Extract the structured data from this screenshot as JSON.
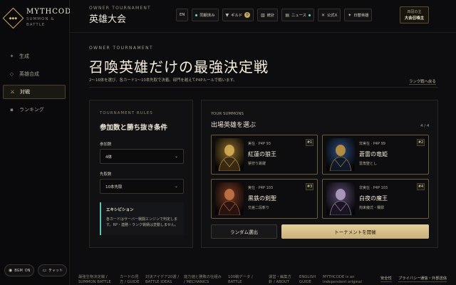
{
  "brand": {
    "name": "MYTHCODE",
    "tagline": "SUMMON & BATTLE",
    "badge": "◆◆◆"
  },
  "sidebar": {
    "items": [
      {
        "label": "生成",
        "icon": "sparkle-icon",
        "glyph": "✦",
        "active": false
      },
      {
        "label": "英雄合成",
        "icon": "diamond-icon",
        "glyph": "◇",
        "active": false
      },
      {
        "label": "対戦",
        "icon": "crossed-swords-icon",
        "glyph": "⚔",
        "active": true
      },
      {
        "label": "ランキング",
        "icon": "trophy-icon",
        "glyph": "▪",
        "active": false
      }
    ],
    "bgm_label": "BGM",
    "bgm_state": "ON",
    "chat_label": "チャット"
  },
  "header": {
    "eyebrow": "OWNER TOURNAMENT",
    "title": "英雄大会",
    "actions": {
      "lang": "EN",
      "synced": "同期済み",
      "guild": "ギルド",
      "guild_count": "0",
      "stats": "統計",
      "news": "ニュース",
      "official": "公式X",
      "daily": "日替英雄"
    },
    "profile": {
      "rank": "四冠の主",
      "title": "大会召喚主"
    }
  },
  "hero": {
    "eyebrow": "OWNER TOURNAMENT",
    "title": "召喚英雄だけの最強決定戦",
    "description": "2〜16体を選び、各カード1〜10本先取で決着。部門を越えてP4Pルールで戦います。",
    "ranking_link": "ランク戦へ戻る"
  },
  "rules": {
    "eyebrow": "TOURNAMENT RULES",
    "title": "参加数と勝ち抜き条件",
    "entrants_label": "参加数",
    "entrants_value": "4体",
    "first_to_label": "先取数",
    "first_to_value": "10本先取",
    "note_title": "エキシビション",
    "note_text": "各カードはサーバー戦闘エンジンで判定します。RP・連勝・ランク戦績は変動しません。"
  },
  "summons": {
    "eyebrow": "YOUR SUMMONS",
    "title": "出場英雄を選ぶ",
    "count": "4 / 4",
    "cards": [
      {
        "num": "#1",
        "meta": "実在 · P4P 93",
        "name": "紅蓮の狼王",
        "skill": "禁狩り跳躍",
        "portrait": "wolf-king-portrait",
        "colors": [
          "#3a2a14",
          "#8a6a2a",
          "#d9b458"
        ]
      },
      {
        "num": "#2",
        "meta": "非実在 · P4P 99",
        "name": "蒼雷の竜姫",
        "skill": "雷角聖とし",
        "portrait": "dragon-princess-portrait",
        "colors": [
          "#101a2c",
          "#2c4a7a",
          "#c99a3a"
        ]
      },
      {
        "num": "#3",
        "meta": "実在 · P4P 103",
        "name": "黒鉄の剣聖",
        "skill": "交差二段斬り",
        "portrait": "sword-saint-portrait",
        "colors": [
          "#2a1410",
          "#7a3a22",
          "#c8784a"
        ]
      },
      {
        "num": "#4",
        "meta": "非実在 · P4P 103",
        "name": "白夜の魔王",
        "skill": "拘束魔式・贖罪",
        "portrait": "demon-king-portrait",
        "colors": [
          "#1a1424",
          "#5a4a6e",
          "#b8a6c8"
        ]
      }
    ],
    "random_button": "ランダム選出",
    "start_button": "トーナメントを開催"
  },
  "footer": {
    "links": [
      "最強生物決定戦 / SUMMON BATTLE",
      "カードの見方 / GUIDE",
      "対決アイデア20選 / BATTLE IDEAS",
      "能力値と勝敗の仕組み / MECHANICS",
      "100戦データ / BATTLE",
      "運営・編集方針 / ABOUT",
      "ENGLISH GUIDE",
      "MYTHCODE is an independent original"
    ],
    "right_links": [
      "安全性",
      "プライバシー",
      "通信・外部送信"
    ]
  },
  "colors": {
    "accent": "#c8a864",
    "teal": "#5bc7b0",
    "bg": "#0d0d10"
  }
}
